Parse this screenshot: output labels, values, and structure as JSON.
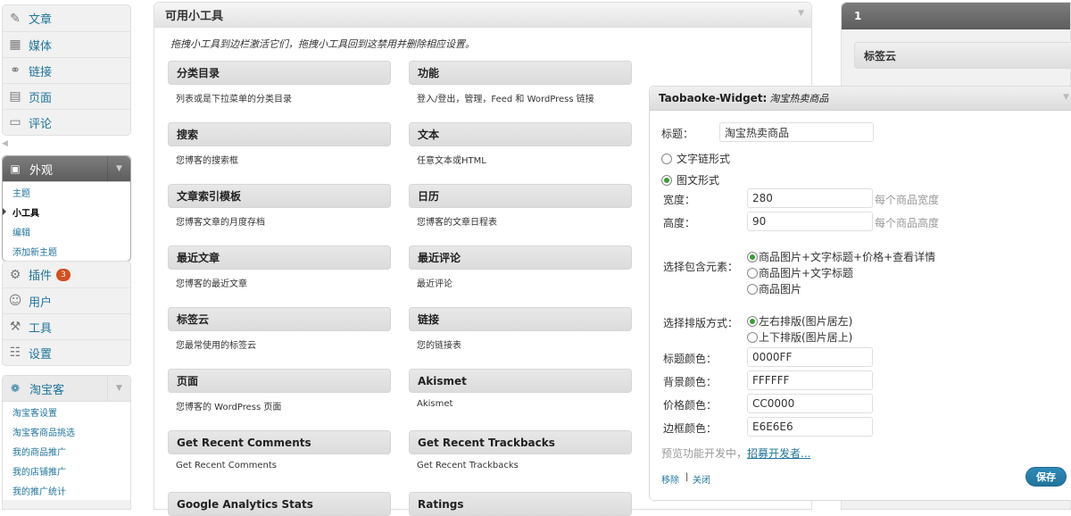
{
  "menu": {
    "group1": [
      {
        "label": "文章",
        "icon": "pin-icon"
      },
      {
        "label": "媒体",
        "icon": "media-icon"
      },
      {
        "label": "链接",
        "icon": "link-icon"
      },
      {
        "label": "页面",
        "icon": "page-icon"
      },
      {
        "label": "评论",
        "icon": "comment-icon"
      }
    ],
    "appearance": {
      "label": "外观",
      "subitems": [
        "主题",
        "小工具",
        "编辑",
        "添加新主题"
      ]
    },
    "group2": [
      {
        "label": "插件",
        "icon": "plugin-icon",
        "badge": "3"
      },
      {
        "label": "用户",
        "icon": "users-icon"
      },
      {
        "label": "工具",
        "icon": "tools-icon"
      },
      {
        "label": "设置",
        "icon": "settings-icon"
      }
    ],
    "taobaoke": {
      "label": "淘宝客",
      "subitems": [
        "淘宝客设置",
        "淘宝客商品挑选",
        "我的商品推广",
        "我的店铺推广",
        "我的推广统计"
      ]
    }
  },
  "available": {
    "title": "可用小工具",
    "description": "拖拽小工具到边栏激活它们，拖拽小工具回到这禁用并删除相应设置。",
    "widgets": [
      {
        "title": "分类目录",
        "desc": "列表或是下拉菜单的分类目录"
      },
      {
        "title": "功能",
        "desc": "登入/登出，管理，Feed 和 WordPress 链接"
      },
      {
        "title": "搜索",
        "desc": "您博客的搜索框"
      },
      {
        "title": "文本",
        "desc": "任意文本或HTML"
      },
      {
        "title": "文章索引模板",
        "desc": "您博客文章的月度存档"
      },
      {
        "title": "日历",
        "desc": "您博客的文章日程表"
      },
      {
        "title": "最近文章",
        "desc": "您博客的最近文章"
      },
      {
        "title": "最近评论",
        "desc": "最近评论"
      },
      {
        "title": "标签云",
        "desc": "您最常使用的标签云"
      },
      {
        "title": "链接",
        "desc": "您的链接表"
      },
      {
        "title": "页面",
        "desc": "您博客的 WordPress 页面"
      },
      {
        "title": "Akismet",
        "desc": "Akismet"
      },
      {
        "title": "Get Recent Comments",
        "desc": "Get Recent Comments"
      },
      {
        "title": "Get Recent Trackbacks",
        "desc": "Get Recent Trackbacks"
      },
      {
        "title": "Google Analytics Stats",
        "desc": ""
      },
      {
        "title": "Ratings",
        "desc": ""
      }
    ]
  },
  "sidebar": {
    "title": "1",
    "widget": "标签云"
  },
  "tbw": {
    "title": "Taobaoke-Widget:",
    "subtitle": "淘宝热卖商品",
    "title_label": "标题：",
    "title_value": "淘宝热卖商品",
    "mode_text": "文字链形式",
    "mode_image": "图文形式",
    "width_label": "宽度：",
    "width_value": "280",
    "width_hint": "每个商品宽度",
    "height_label": "高度：",
    "height_value": "90",
    "height_hint": "每个商品高度",
    "elements_label": "选择包含元素：",
    "elements_options": [
      "商品图片+文字标题+价格+查看详情",
      "商品图片+文字标题",
      "商品图片"
    ],
    "layout_label": "选择排版方式：",
    "layout_options": [
      "左右排版(图片居左)",
      "上下排版(图片居上)"
    ],
    "title_color_label": "标题颜色：",
    "title_color": "0000FF",
    "bg_color_label": "背景颜色：",
    "bg_color": "FFFFFF",
    "price_color_label": "价格颜色：",
    "price_color": "CC0000",
    "border_color_label": "边框颜色：",
    "border_color": "E6E6E6",
    "preview_text": "预览功能开发中，",
    "preview_link": "招募开发者...",
    "remove_link": "移除",
    "separator": "|",
    "close_link": "关闭",
    "save_label": "保存"
  }
}
